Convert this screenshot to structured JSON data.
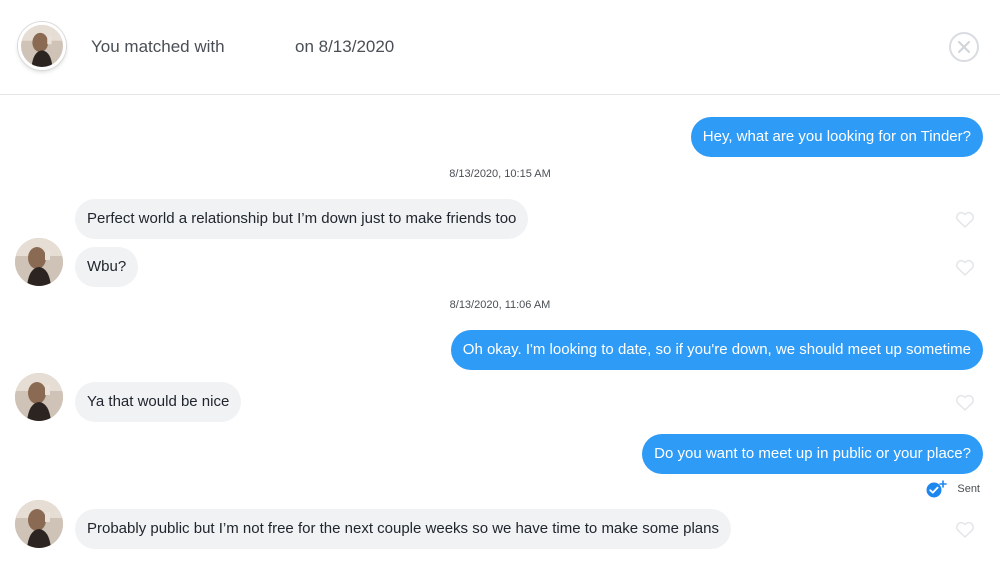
{
  "header": {
    "match_label": "You matched with",
    "match_date": "on 8/13/2020",
    "close_icon": "close-circle-icon"
  },
  "conversation": {
    "out_color": "#2e9bf6",
    "in_color": "#f0f2f4",
    "messages": [
      {
        "kind": "outgoing",
        "text": "Hey, what are you looking for on Tinder?"
      },
      {
        "kind": "timestamp",
        "text": "8/13/2020, 10:15 AM"
      },
      {
        "kind": "incoming",
        "text": "Perfect world a relationship but I’m down just to make friends too"
      },
      {
        "kind": "incoming",
        "text": "Wbu?"
      },
      {
        "kind": "timestamp",
        "text": "8/13/2020, 11:06 AM"
      },
      {
        "kind": "outgoing",
        "text": "Oh okay. I'm looking to date, so if you're down, we should meet up sometime"
      },
      {
        "kind": "incoming",
        "text": "Ya that would be nice"
      },
      {
        "kind": "outgoing",
        "text": "Do you want to meet up in public or your place?"
      },
      {
        "kind": "incoming",
        "text": "Probably public but I’m not free for the next couple weeks so we have time to make some plans"
      }
    ],
    "sent_status": "Sent",
    "sent_icon": "checkmark-sparkle-icon",
    "like_icon": "heart-outline-icon"
  }
}
